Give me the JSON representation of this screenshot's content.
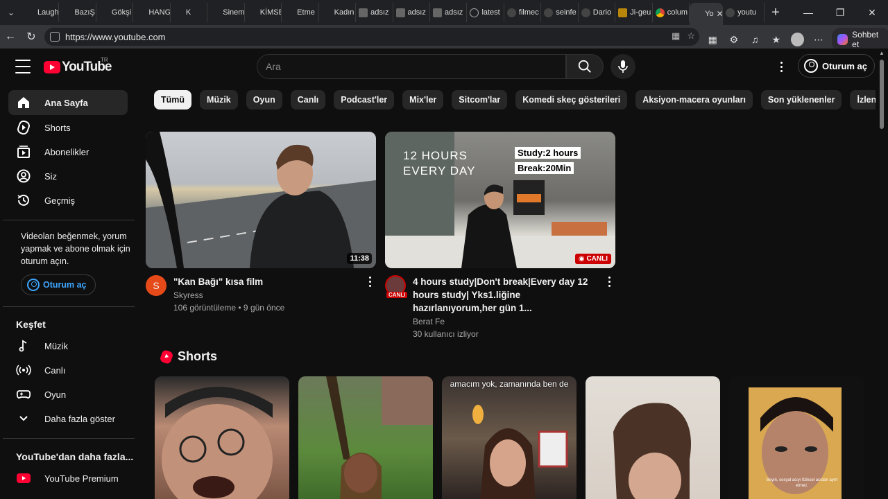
{
  "browser": {
    "tabs": [
      {
        "label": "Laugh",
        "icon": "yt"
      },
      {
        "label": "BazıŞ",
        "icon": "yt"
      },
      {
        "label": "Gökşi",
        "icon": "yt"
      },
      {
        "label": "HANG",
        "icon": "yt"
      },
      {
        "label": "K",
        "icon": "yt"
      },
      {
        "label": "Sinem",
        "icon": "yt"
      },
      {
        "label": "KİMSE",
        "icon": "yt"
      },
      {
        "label": "Etme",
        "icon": "yt"
      },
      {
        "label": "Kadın",
        "icon": "yt"
      },
      {
        "label": "adsız",
        "icon": "gray"
      },
      {
        "label": "adsız",
        "icon": "gray"
      },
      {
        "label": "adsız",
        "icon": "gray"
      },
      {
        "label": "latest",
        "icon": "globe"
      },
      {
        "label": "filmec",
        "icon": "g"
      },
      {
        "label": "seinfe",
        "icon": "g"
      },
      {
        "label": "Dario",
        "icon": "g"
      },
      {
        "label": "Ji-geu",
        "icon": "gold"
      },
      {
        "label": "colum",
        "icon": "chrome"
      },
      {
        "label": "Yo",
        "icon": "yt",
        "active": true
      },
      {
        "label": "youtu",
        "icon": "g"
      }
    ],
    "url": "https://www.youtube.com",
    "copilot_label": "Sohbet et"
  },
  "masthead": {
    "logo_text": "YouTube",
    "country_code": "TR",
    "search_placeholder": "Ara",
    "signin_label": "Oturum aç"
  },
  "sidebar": {
    "main_items": [
      {
        "label": "Ana Sayfa",
        "icon": "home-icon"
      },
      {
        "label": "Shorts",
        "icon": "shorts-icon"
      },
      {
        "label": "Abonelikler",
        "icon": "subscriptions-icon"
      },
      {
        "label": "Siz",
        "icon": "you-icon"
      },
      {
        "label": "Geçmiş",
        "icon": "history-icon"
      }
    ],
    "signin_note": "Videoları beğenmek, yorum yapmak ve abone olmak için oturum açın.",
    "signin_label": "Oturum aç",
    "explore_heading": "Keşfet",
    "explore_items": [
      {
        "label": "Müzik",
        "icon": "music-icon"
      },
      {
        "label": "Canlı",
        "icon": "live-icon"
      },
      {
        "label": "Oyun",
        "icon": "gaming-icon"
      },
      {
        "label": "Daha fazla göster",
        "icon": "chevron-down-icon"
      }
    ],
    "more_heading": "YouTube'dan daha fazla...",
    "more_items": [
      {
        "label": "YouTube Premium",
        "icon": "youtube-premium-icon"
      }
    ]
  },
  "chips": [
    "Tümü",
    "Müzik",
    "Oyun",
    "Canlı",
    "Podcast'ler",
    "Mix'ler",
    "Sitcom'lar",
    "Komedi skeç gösterileri",
    "Aksiyon-macera oyunları",
    "Son yüklenenler",
    "İzlenenler"
  ],
  "videos": [
    {
      "title": "\"Kan Bağı\" kısa film",
      "channel": "Skyress",
      "stats": "106 görüntüleme • 9 gün önce",
      "duration": "11:38",
      "avatar_letter": "S",
      "avatar_color": "#e64a19"
    },
    {
      "title": "4 hours study|Don't break|Every day 12 hours study| Yks1.liğine hazırlanıyorum,her gün 1...",
      "channel": "Berat Fe",
      "stats": "30 kullanıcı izliyor",
      "live_badge": "CANLI",
      "avatar_live_tag": "CANLI",
      "thumb_text_1": "12 HOURS",
      "thumb_text_2": "EVERY DAY",
      "thumb_text_3": "Study:2 hours",
      "thumb_text_4": "Break:20Min"
    }
  ],
  "shorts": {
    "heading": "Shorts",
    "items": [
      {
        "caption": ""
      },
      {
        "caption": ""
      },
      {
        "caption": "amacım yok, zamanında ben de"
      },
      {
        "caption": ""
      },
      {
        "caption": "Beyin, sosyal acıyı fiziksel acıdan ayırt etmez."
      }
    ]
  },
  "colors": {
    "brand_red": "#ff0033",
    "link_blue": "#3ea6ff",
    "background": "#0f0f0f"
  }
}
